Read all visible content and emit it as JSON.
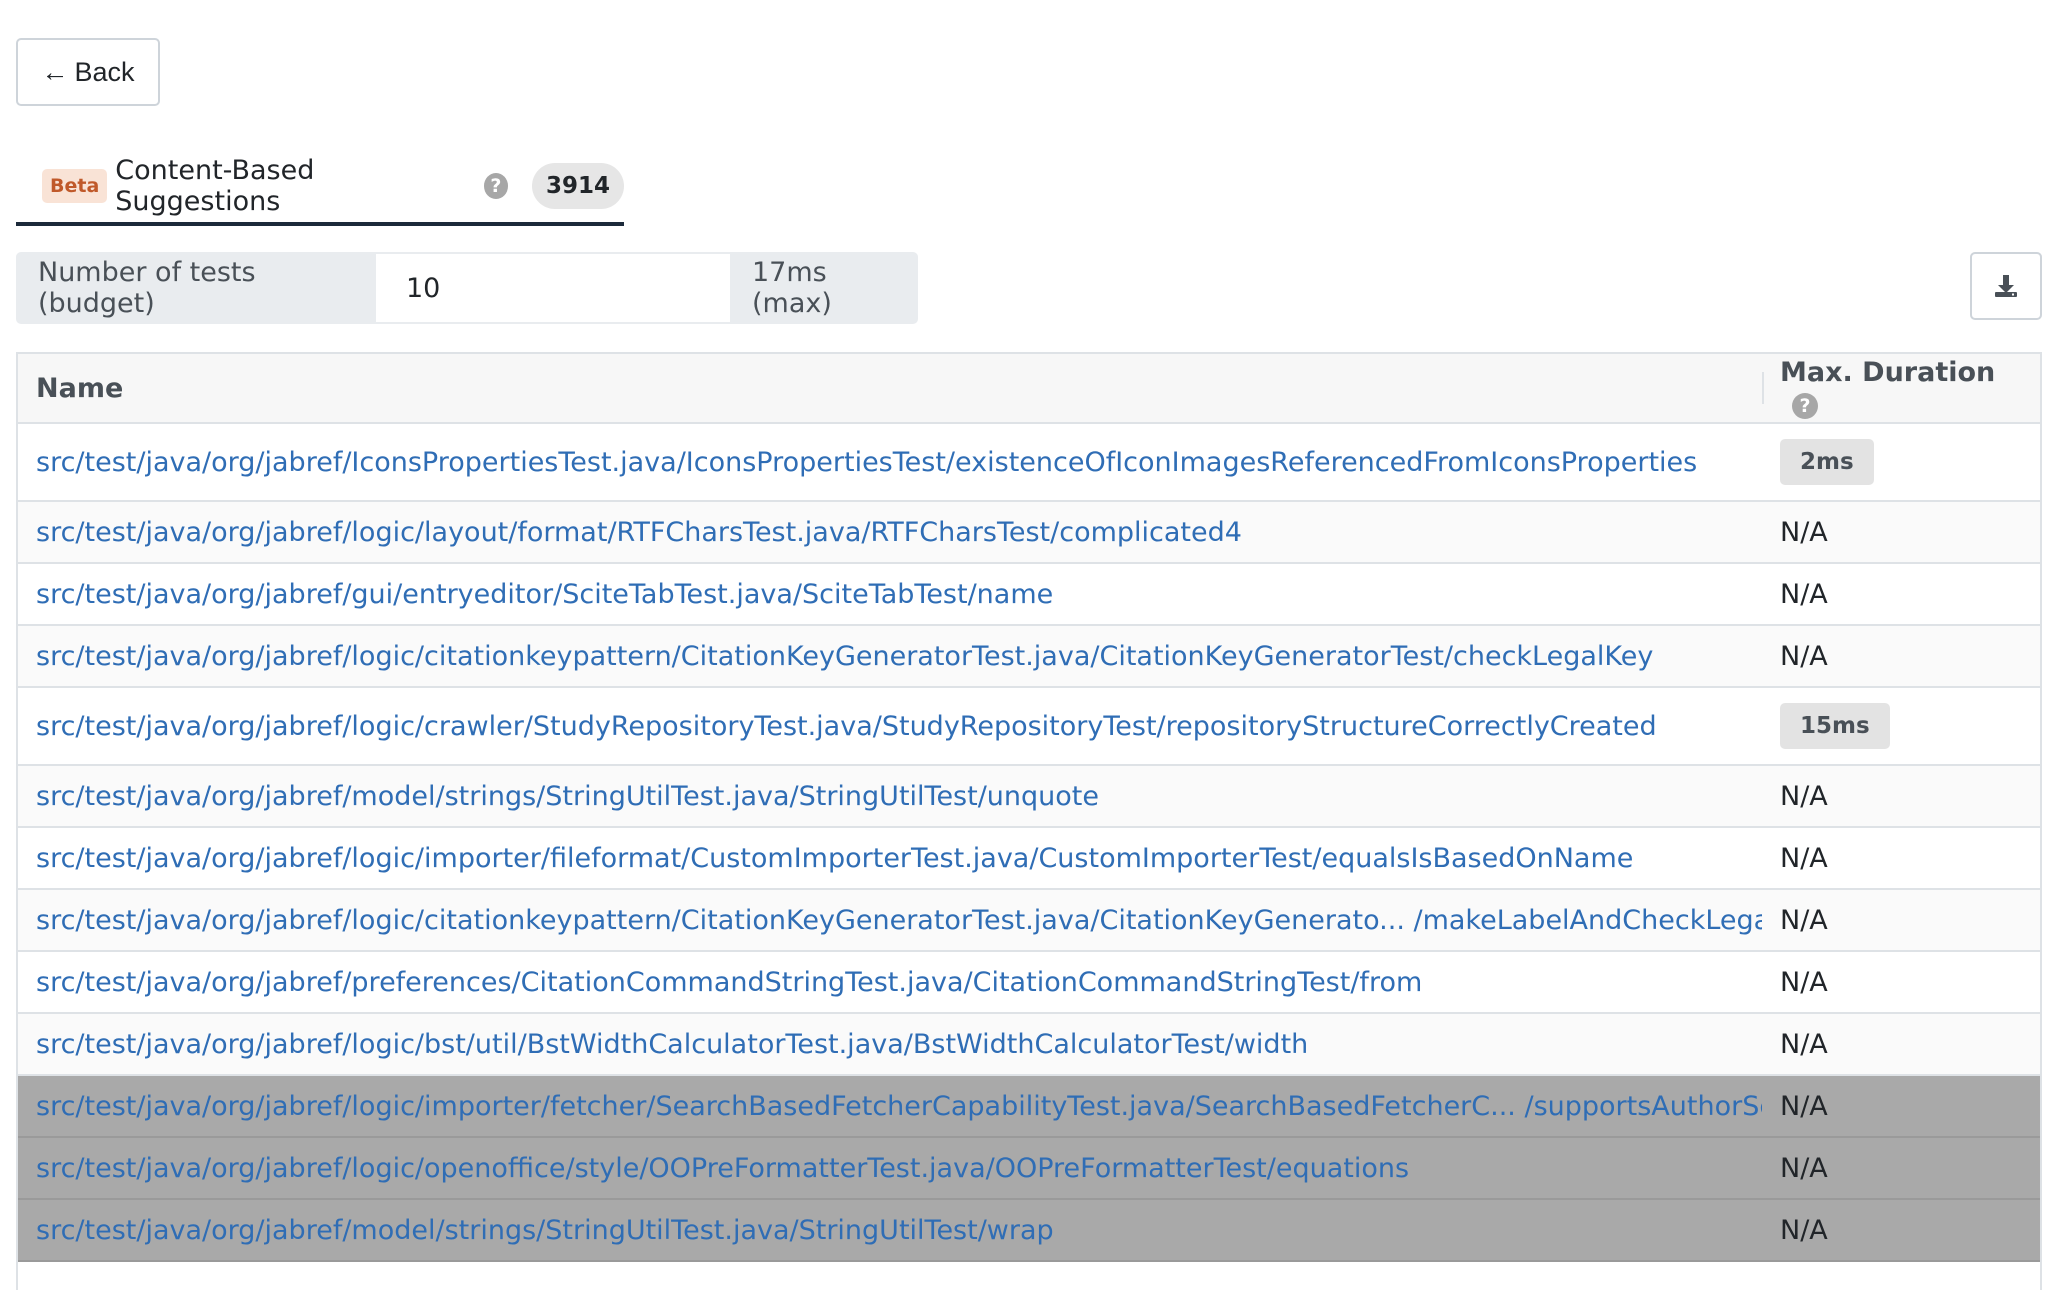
{
  "back_button": {
    "arrow": "←",
    "label": "Back"
  },
  "tab": {
    "badge": "Beta",
    "label": "Content-Based Suggestions",
    "help_icon": "?",
    "count": "3914"
  },
  "budget": {
    "label": "Number of tests (budget)",
    "value": "10",
    "max_label": "17ms (max)"
  },
  "download_icon": "download-icon",
  "table": {
    "headers": {
      "name": "Name",
      "duration": "Max. Duration"
    },
    "rows": [
      {
        "name": "src/test/java/org/jabref/IconsPropertiesTest.java/IconsPropertiesTest/existenceOfIconImagesReferencedFromIconsProperties",
        "duration": "2ms",
        "badge": true
      },
      {
        "name": "src/test/java/org/jabref/logic/layout/format/RTFCharsTest.java/RTFCharsTest/complicated4",
        "duration": "N/A",
        "badge": false
      },
      {
        "name": "src/test/java/org/jabref/gui/entryeditor/SciteTabTest.java/SciteTabTest/name",
        "duration": "N/A",
        "badge": false
      },
      {
        "name": "src/test/java/org/jabref/logic/citationkeypattern/CitationKeyGeneratorTest.java/CitationKeyGeneratorTest/checkLegalKey",
        "duration": "N/A",
        "badge": false
      },
      {
        "name": "src/test/java/org/jabref/logic/crawler/StudyRepositoryTest.java/StudyRepositoryTest/repositoryStructureCorrectlyCreated",
        "duration": "15ms",
        "badge": true
      },
      {
        "name": "src/test/java/org/jabref/model/strings/StringUtilTest.java/StringUtilTest/unquote",
        "duration": "N/A",
        "badge": false
      },
      {
        "name": "src/test/java/org/jabref/logic/importer/fileformat/CustomImporterTest.java/CustomImporterTest/equalsIsBasedOnName",
        "duration": "N/A",
        "badge": false
      },
      {
        "name": "src/test/java/org/jabref/logic/citationkeypattern/CitationKeyGeneratorTest.java/CitationKeyGenerato... /makeLabelAndCheckLegalKeys",
        "duration": "N/A",
        "badge": false
      },
      {
        "name": "src/test/java/org/jabref/preferences/CitationCommandStringTest.java/CitationCommandStringTest/from",
        "duration": "N/A",
        "badge": false
      },
      {
        "name": "src/test/java/org/jabref/logic/bst/util/BstWidthCalculatorTest.java/BstWidthCalculatorTest/width",
        "duration": "N/A",
        "badge": false
      },
      {
        "name": "src/test/java/org/jabref/logic/importer/fetcher/SearchBasedFetcherCapabilityTest.java/SearchBasedFetcherC... /supportsAuthorSearch",
        "duration": "N/A",
        "badge": false,
        "dim": true
      },
      {
        "name": "src/test/java/org/jabref/logic/openoffice/style/OOPreFormatterTest.java/OOPreFormatterTest/equations",
        "duration": "N/A",
        "badge": false,
        "dim": true
      },
      {
        "name": "src/test/java/org/jabref/model/strings/StringUtilTest.java/StringUtilTest/wrap",
        "duration": "N/A",
        "badge": false,
        "dim": true
      }
    ]
  }
}
